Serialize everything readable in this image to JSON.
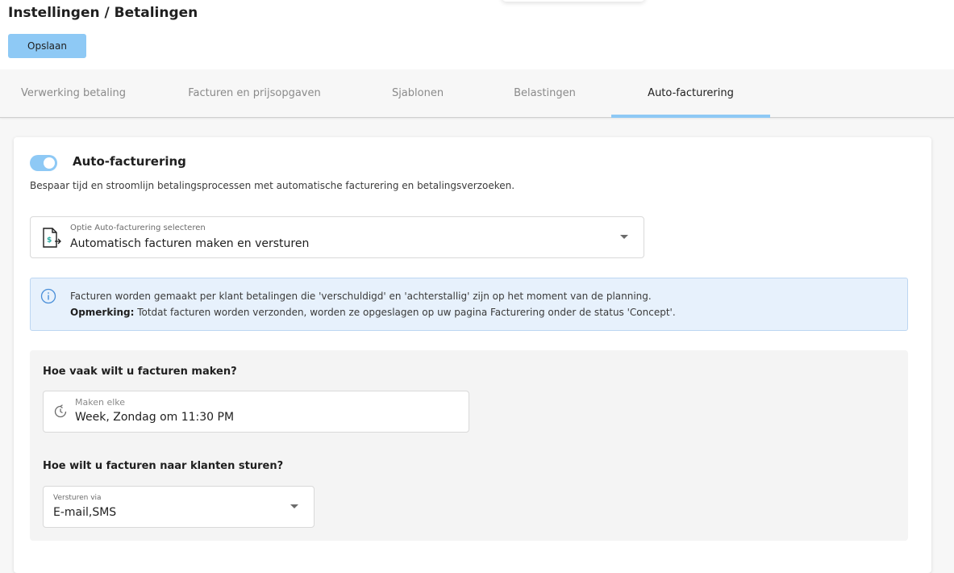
{
  "header": {
    "title": "Instellingen / Betalingen",
    "save_label": "Opslaan"
  },
  "tabs": [
    {
      "label": "Verwerking betaling",
      "active": false
    },
    {
      "label": "Facturen en prijsopgaven",
      "active": false
    },
    {
      "label": "Sjablonen",
      "active": false
    },
    {
      "label": "Belastingen",
      "active": false
    },
    {
      "label": "Auto-facturering",
      "active": true
    }
  ],
  "auto_invoicing": {
    "enabled": true,
    "title": "Auto-facturering",
    "description": "Bespaar tijd en stroomlijn betalingsprocessen met automatische facturering en betalingsverzoeken.",
    "option_select": {
      "label": "Optie Auto-facturering selecteren",
      "value": "Automatisch facturen maken en versturen",
      "icon": "invoice-send-icon"
    },
    "info": {
      "line1": "Facturen worden gemaakt per klant betalingen die 'verschuldigd' en 'achterstallig' zijn op het moment van de planning.",
      "note_label": "Opmerking:",
      "note_text": " Totdat facturen worden verzonden, worden ze opgeslagen op uw pagina Facturering onder de status 'Concept'."
    },
    "frequency": {
      "question": "Hoe vaak wilt u facturen maken?",
      "label": "Maken elke",
      "value": "Week, Zondag om 11:30 PM",
      "icon": "schedule-clock-icon"
    },
    "send": {
      "question": "Hoe wilt u facturen naar klanten sturen?",
      "label": "Versturen via",
      "value": "E-mail,SMS"
    }
  },
  "colors": {
    "accent": "#8ec9f5",
    "info_bg": "#e7f1fc",
    "info_icon": "#4a8fd9"
  }
}
